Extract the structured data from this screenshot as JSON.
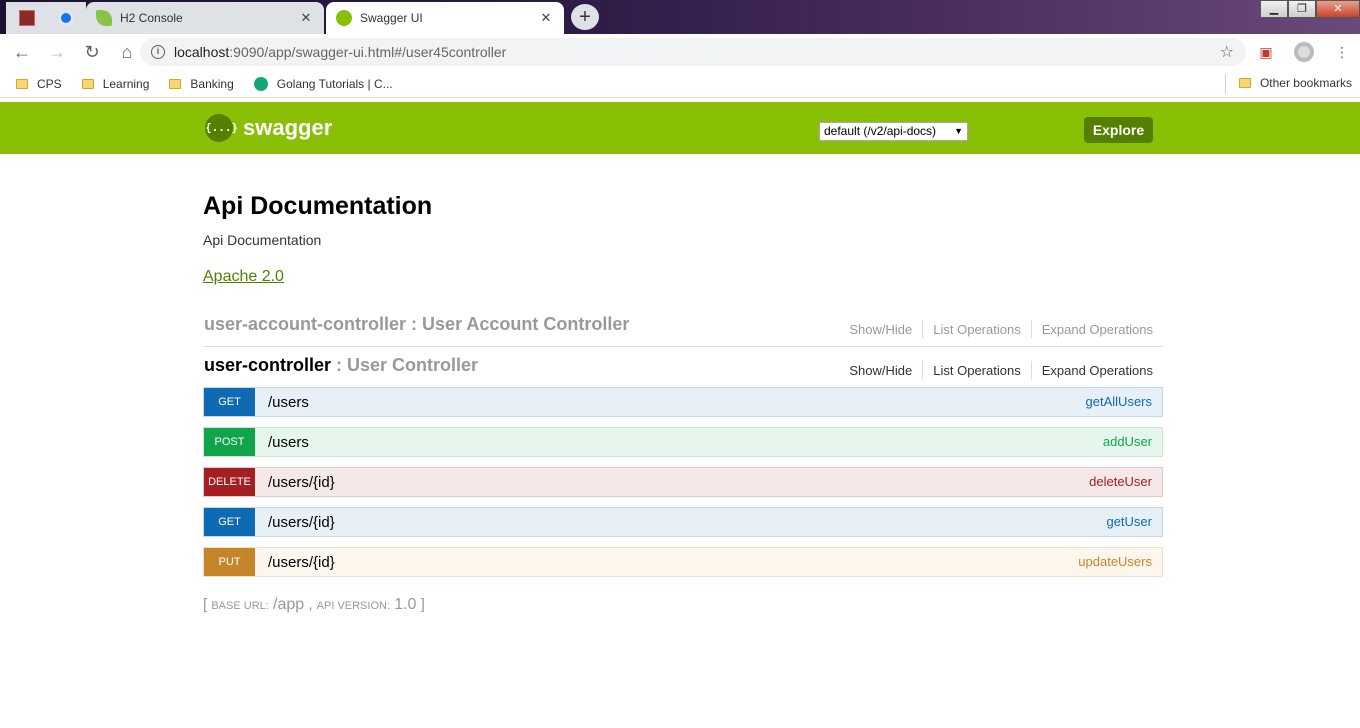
{
  "browser": {
    "tabs": [
      {
        "title": "H2 Console",
        "active": false
      },
      {
        "title": "Swagger UI",
        "active": true
      }
    ],
    "new_tab_label": "+",
    "address": {
      "host": "localhost",
      "path": ":9090/app/swagger-ui.html#/user45controller"
    },
    "bookmarks": [
      "CPS",
      "Learning",
      "Banking",
      "Golang Tutorials | C..."
    ],
    "other_bookmarks": "Other bookmarks"
  },
  "swagger": {
    "logo_text": "swagger",
    "logo_glyph": "{...}",
    "api_selector": "default (/v2/api-docs)",
    "explore_label": "Explore",
    "brand_color": "#89bf04"
  },
  "api": {
    "title": "Api Documentation",
    "description": "Api Documentation",
    "license": "Apache 2.0"
  },
  "resources": [
    {
      "name": "user-account-controller",
      "separator": " : ",
      "description": "User Account Controller",
      "links": [
        "Show/Hide",
        "List Operations",
        "Expand Operations"
      ]
    },
    {
      "name": "user-controller",
      "separator": " : ",
      "description": "User Controller",
      "links": [
        "Show/Hide",
        "List Operations",
        "Expand Operations"
      ]
    }
  ],
  "operations": [
    {
      "method": "GET",
      "path": "/users",
      "name": "getAllUsers",
      "color": "#0f6ab4",
      "bg": "#e7f0f7",
      "border": "#c3d9ec",
      "text": "#0f6ab4"
    },
    {
      "method": "POST",
      "path": "/users",
      "name": "addUser",
      "color": "#10a54a",
      "bg": "#e7f6ec",
      "border": "#c3e8d1",
      "text": "#10a54a"
    },
    {
      "method": "DELETE",
      "path": "/users/{id}",
      "name": "deleteUser",
      "color": "#a41e22",
      "bg": "#f5e8e8",
      "border": "#e8c6c7",
      "text": "#a41e22"
    },
    {
      "method": "GET",
      "path": "/users/{id}",
      "name": "getUser",
      "color": "#0f6ab4",
      "bg": "#e7f0f7",
      "border": "#c3d9ec",
      "text": "#0f6ab4"
    },
    {
      "method": "PUT",
      "path": "/users/{id}",
      "name": "updateUsers",
      "color": "#c5862b",
      "bg": "#fcf6ed",
      "border": "#f0e0ca",
      "text": "#c5862b"
    }
  ],
  "footer": {
    "open": "[",
    "base_url_label": "BASE URL",
    "base_url": "/app",
    "comma": ",",
    "api_version_label": "API VERSION",
    "api_version": "1.0",
    "close": "]"
  }
}
